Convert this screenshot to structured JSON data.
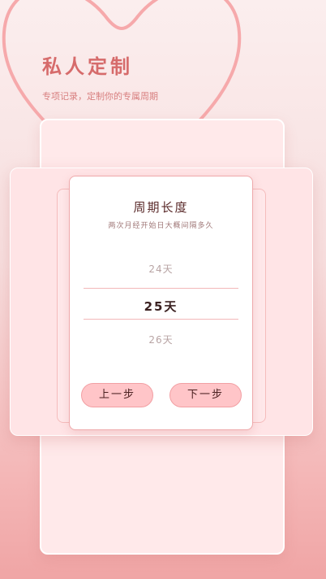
{
  "hero": {
    "title": "私人定制",
    "subtitle": "专项记录，定制你的专属周期"
  },
  "dialog": {
    "title": "周期长度",
    "subtitle": "两次月经开始日大概间隔多久",
    "picker": {
      "prev": "24天",
      "selected": "25天",
      "next": "26天"
    },
    "buttons": {
      "prev_label": "上一步",
      "next_label": "下一步"
    }
  },
  "colors": {
    "accent": "#d66b6b",
    "button_fill": "#ffc5c8",
    "button_border": "#f29fa3",
    "dialog_border": "#efa9ab"
  }
}
